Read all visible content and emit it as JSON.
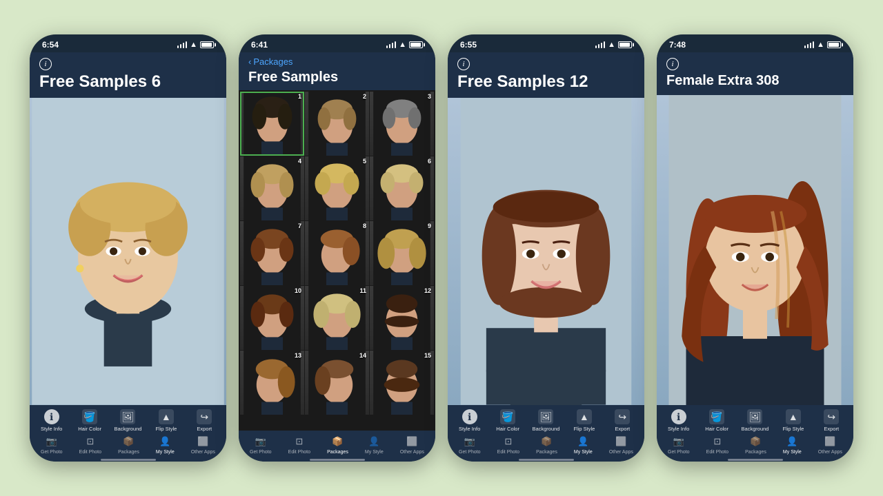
{
  "background_color": "#d8e8c8",
  "phones": [
    {
      "id": "phone1",
      "status_time": "6:54",
      "header_title": "Free Samples 6",
      "view_type": "portrait",
      "active_tab": "My Style",
      "toolbar_items": [
        {
          "label": "Style Info",
          "icon": "ℹ"
        },
        {
          "label": "Hair Color",
          "icon": "🪣"
        },
        {
          "label": "Background",
          "icon": "🖼"
        },
        {
          "label": "Flip Style",
          "icon": "▲"
        },
        {
          "label": "Export",
          "icon": "↪"
        }
      ],
      "tab_items": [
        {
          "label": "Get Photo",
          "icon": "📷"
        },
        {
          "label": "Edit Photo",
          "icon": "⊡"
        },
        {
          "label": "Packages",
          "icon": "📦"
        },
        {
          "label": "My Style",
          "icon": "👤",
          "active": true
        },
        {
          "label": "Other Apps",
          "icon": "⬜"
        }
      ]
    },
    {
      "id": "phone2",
      "status_time": "6:41",
      "back_label": "Packages",
      "header_title": "Free Samples",
      "view_type": "grid",
      "grid_items": 15,
      "selected_item": 1,
      "active_tab": "Packages",
      "toolbar_items": [
        {
          "label": "Get Photo",
          "icon": "📷"
        },
        {
          "label": "Edit Photo",
          "icon": "⊡"
        },
        {
          "label": "Packages",
          "icon": "📦",
          "active": true
        },
        {
          "label": "My Style",
          "icon": "👤"
        },
        {
          "label": "Other Apps",
          "icon": "⬜"
        }
      ]
    },
    {
      "id": "phone3",
      "status_time": "6:55",
      "header_title": "Free Samples 12",
      "view_type": "portrait",
      "active_tab": "My Style",
      "toolbar_items": [
        {
          "label": "Style Info",
          "icon": "ℹ"
        },
        {
          "label": "Hair Color",
          "icon": "🪣"
        },
        {
          "label": "Background",
          "icon": "🖼"
        },
        {
          "label": "Flip Style",
          "icon": "▲"
        },
        {
          "label": "Export",
          "icon": "↪"
        }
      ],
      "tab_items": [
        {
          "label": "Get Photo",
          "icon": "📷"
        },
        {
          "label": "Edit Photo",
          "icon": "⊡"
        },
        {
          "label": "Packages",
          "icon": "📦"
        },
        {
          "label": "My Style",
          "icon": "👤",
          "active": true
        },
        {
          "label": "Other Apps",
          "icon": "⬜"
        }
      ]
    },
    {
      "id": "phone4",
      "status_time": "7:48",
      "header_title": "Female Extra 308",
      "view_type": "portrait",
      "active_tab": "My Style",
      "toolbar_items": [
        {
          "label": "Style Info",
          "icon": "ℹ"
        },
        {
          "label": "Hair Color",
          "icon": "🪣"
        },
        {
          "label": "Background",
          "icon": "🖼"
        },
        {
          "label": "Flip Style",
          "icon": "▲"
        },
        {
          "label": "Export",
          "icon": "↪"
        }
      ],
      "tab_items": [
        {
          "label": "Get Photo",
          "icon": "📷"
        },
        {
          "label": "Edit Photo",
          "icon": "⊡"
        },
        {
          "label": "Packages",
          "icon": "📦"
        },
        {
          "label": "My Style",
          "icon": "👤",
          "active": true
        },
        {
          "label": "Other Apps",
          "icon": "⬜"
        }
      ]
    }
  ]
}
